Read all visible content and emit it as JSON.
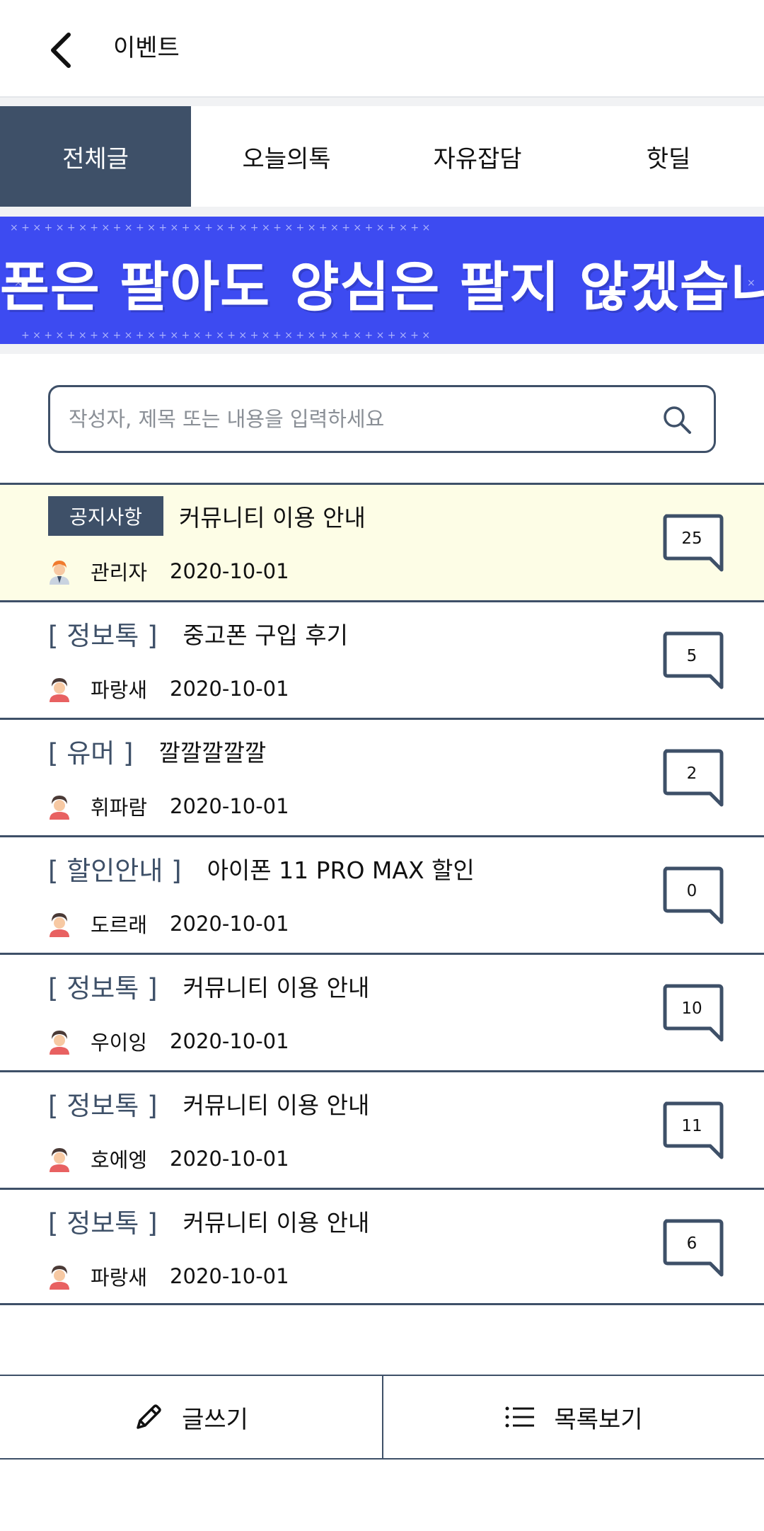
{
  "header": {
    "title": "이벤트",
    "back_icon": "chevron-left-icon"
  },
  "tabs": [
    {
      "label": "전체글",
      "active": true
    },
    {
      "label": "오늘의톡",
      "active": false
    },
    {
      "label": "자유잡담",
      "active": false
    },
    {
      "label": "핫딜",
      "active": false
    }
  ],
  "banner": {
    "text": "폰은 팔아도 양심은 팔지 않겠습니다",
    "background": "#3d4bf1"
  },
  "search": {
    "placeholder": "작성자, 제목 또는 내용을 입력하세요",
    "value": "",
    "icon": "search-icon"
  },
  "posts": [
    {
      "notice": true,
      "badge": "공지사항",
      "category": "",
      "title": "커뮤니티 이용 안내",
      "author": "관리자",
      "date": "2020-10-01",
      "comments": "25"
    },
    {
      "notice": false,
      "badge": "",
      "category": "[ 정보톡 ]",
      "title": "중고폰 구입 후기",
      "author": "파랑새",
      "date": "2020-10-01",
      "comments": "5"
    },
    {
      "notice": false,
      "badge": "",
      "category": "[ 유머 ]",
      "title": "깔깔깔깔깔",
      "author": "휘파람",
      "date": "2020-10-01",
      "comments": "2"
    },
    {
      "notice": false,
      "badge": "",
      "category": "[ 할인안내 ]",
      "title": "아이폰 11 PRO MAX 할인",
      "author": "도르래",
      "date": "2020-10-01",
      "comments": "0"
    },
    {
      "notice": false,
      "badge": "",
      "category": "[ 정보톡 ]",
      "title": "커뮤니티 이용 안내",
      "author": "우이잉",
      "date": "2020-10-01",
      "comments": "10"
    },
    {
      "notice": false,
      "badge": "",
      "category": "[ 정보톡 ]",
      "title": "커뮤니티 이용 안내",
      "author": "호에엥",
      "date": "2020-10-01",
      "comments": "11"
    },
    {
      "notice": false,
      "badge": "",
      "category": "[ 정보톡 ]",
      "title": "커뮤니티 이용 안내",
      "author": "파랑새",
      "date": "2020-10-01",
      "comments": "6"
    }
  ],
  "bottom": {
    "write_label": "글쓰기",
    "write_icon": "pencil-icon",
    "list_label": "목록보기",
    "list_icon": "list-icon"
  },
  "colors": {
    "primary": "#3e5068",
    "notice_bg": "#fdfde6",
    "banner_bg": "#3d4bf1"
  }
}
